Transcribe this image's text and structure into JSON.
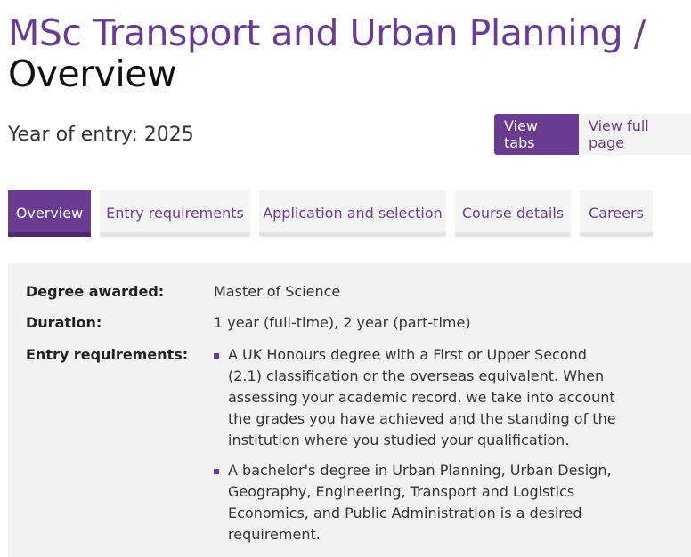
{
  "heading": {
    "crumb": "MSc Transport and Urban Planning /",
    "current": "Overview"
  },
  "year_of_entry": "Year of entry: 2025",
  "view_toggle": {
    "tabs_label": "View tabs",
    "full_label": "View full page"
  },
  "tabs": [
    {
      "label": "Overview",
      "active": true
    },
    {
      "label": "Entry requirements",
      "active": false
    },
    {
      "label": "Application and selection",
      "active": false
    },
    {
      "label": "Course details",
      "active": false
    },
    {
      "label": "Careers",
      "active": false
    }
  ],
  "summary": {
    "degree_label": "Degree awarded:",
    "degree_value": "Master of Science",
    "duration_label": "Duration:",
    "duration_value": "1 year (full-time), 2 year (part-time)",
    "entry_label": "Entry requirements:",
    "entry_items": [
      "A UK Honours degree with a First or Upper Second (2.1) classification or the overseas equivalent. When assessing your academic record, we take into account the grades you have achieved and the standing of the institution where you studied your qualification.",
      "A bachelor's degree in Urban Planning, Urban Design, Geography, Engineering, Transport and Logistics Economics, and Public Administration is a desired requirement."
    ]
  },
  "colors": {
    "brand_purple": "#6a3c91",
    "panel_grey": "#f2f2f2"
  }
}
